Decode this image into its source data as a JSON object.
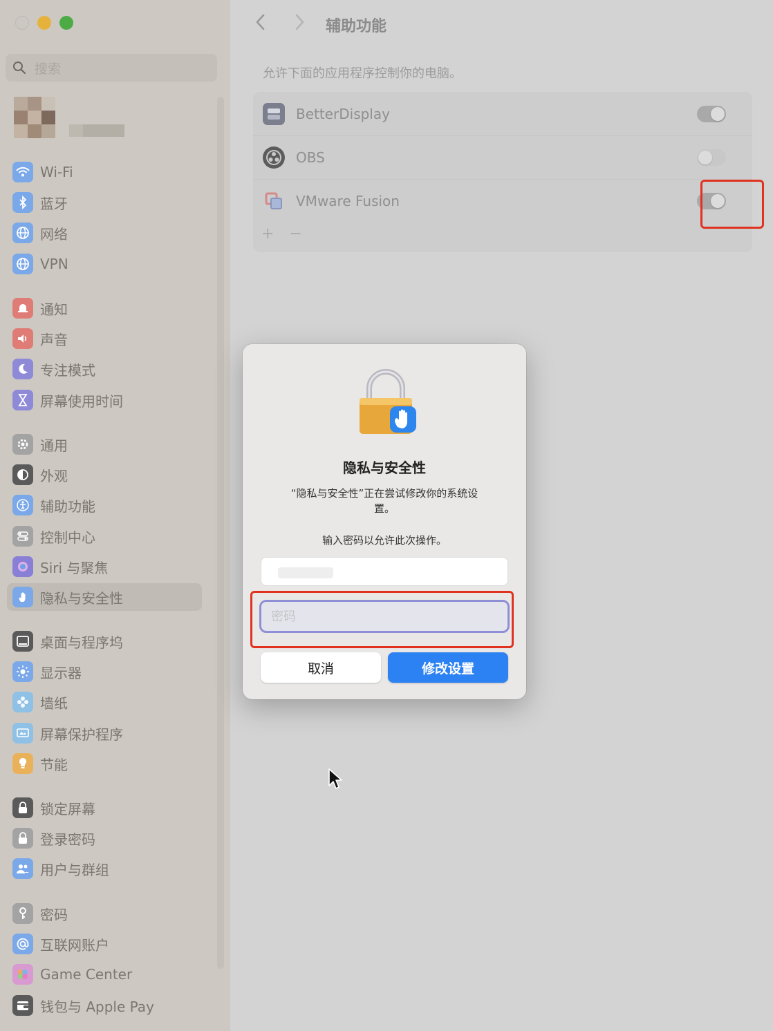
{
  "sidebar": {
    "search_placeholder": "搜索",
    "groups": [
      [
        {
          "label": "Wi-Fi",
          "icon": "wifi-icon",
          "color": "#7aa8e8",
          "glyph": "wifi"
        },
        {
          "label": "蓝牙",
          "icon": "bluetooth-icon",
          "color": "#7aa8e8",
          "glyph": "bt"
        },
        {
          "label": "网络",
          "icon": "network-globe-icon",
          "color": "#7aa8e8",
          "glyph": "globe"
        },
        {
          "label": "VPN",
          "icon": "vpn-globe-icon",
          "color": "#7aa8e8",
          "glyph": "globe"
        }
      ],
      [
        {
          "label": "通知",
          "icon": "notification-bell-icon",
          "color": "#e07c76",
          "glyph": "bell"
        },
        {
          "label": "声音",
          "icon": "speaker-icon",
          "color": "#e07c76",
          "glyph": "speaker"
        },
        {
          "label": "专注模式",
          "icon": "moon-icon",
          "color": "#8f8ad8",
          "glyph": "moon"
        },
        {
          "label": "屏幕使用时间",
          "icon": "hourglass-icon",
          "color": "#8f8ad8",
          "glyph": "hourglass"
        }
      ],
      [
        {
          "label": "通用",
          "icon": "gear-icon",
          "color": "#a3a3a3",
          "glyph": "gear"
        },
        {
          "label": "外观",
          "icon": "appearance-icon",
          "color": "#5a5a5a",
          "glyph": "appearance"
        },
        {
          "label": "辅助功能",
          "icon": "accessibility-icon",
          "color": "#7aa8e8",
          "glyph": "access"
        },
        {
          "label": "控制中心",
          "icon": "control-center-icon",
          "color": "#a3a3a3",
          "glyph": "toggles"
        },
        {
          "label": "Siri 与聚焦",
          "icon": "siri-icon",
          "color": "#8a7fd6",
          "glyph": "siri"
        },
        {
          "label": "隐私与安全性",
          "icon": "privacy-hand-icon",
          "color": "#7aa8e8",
          "glyph": "hand"
        }
      ],
      [
        {
          "label": "桌面与程序坞",
          "icon": "dock-icon",
          "color": "#5a5a5a",
          "glyph": "dock"
        },
        {
          "label": "显示器",
          "icon": "display-brightness-icon",
          "color": "#7aa8e8",
          "glyph": "sun"
        },
        {
          "label": "墙纸",
          "icon": "wallpaper-icon",
          "color": "#8fc0e6",
          "glyph": "flower"
        },
        {
          "label": "屏幕保护程序",
          "icon": "screensaver-icon",
          "color": "#8fc0e6",
          "glyph": "screen"
        },
        {
          "label": "节能",
          "icon": "energy-bulb-icon",
          "color": "#e9b25a",
          "glyph": "bulb"
        }
      ],
      [
        {
          "label": "锁定屏幕",
          "icon": "lock-screen-icon",
          "color": "#5a5a5a",
          "glyph": "lock"
        },
        {
          "label": "登录密码",
          "icon": "login-lock-icon",
          "color": "#a3a3a3",
          "glyph": "lock"
        },
        {
          "label": "用户与群组",
          "icon": "users-icon",
          "color": "#7aa8e8",
          "glyph": "users"
        }
      ],
      [
        {
          "label": "密码",
          "icon": "key-icon",
          "color": "#a3a3a3",
          "glyph": "key"
        },
        {
          "label": "互联网账户",
          "icon": "at-sign-icon",
          "color": "#7aa8e8",
          "glyph": "at"
        },
        {
          "label": "Game Center",
          "icon": "game-center-icon",
          "color": "#d89ad0",
          "glyph": "bubbles"
        },
        {
          "label": "钱包与 Apple Pay",
          "icon": "wallet-icon",
          "color": "#5a5a5a",
          "glyph": "wallet"
        }
      ]
    ],
    "selected_label": "隐私与安全性"
  },
  "main": {
    "title": "辅助功能",
    "description": "允许下面的应用程序控制你的电脑。",
    "apps": [
      {
        "name": "BetterDisplay",
        "icon": "betterdisplay-icon",
        "enabled": true
      },
      {
        "name": "OBS",
        "icon": "obs-icon",
        "enabled": false
      },
      {
        "name": "VMware Fusion",
        "icon": "vmware-fusion-icon",
        "enabled": true
      }
    ],
    "add_label": "+",
    "remove_label": "−"
  },
  "dialog": {
    "title": "隐私与安全性",
    "message": "“隐私与安全性”正在尝试修改你的系统设置。",
    "prompt": "输入密码以允许此次操作。",
    "password_placeholder": "密码",
    "cancel_label": "取消",
    "confirm_label": "修改设置"
  },
  "colors": {
    "accent": "#2c82f2",
    "highlight": "#e0321f"
  }
}
